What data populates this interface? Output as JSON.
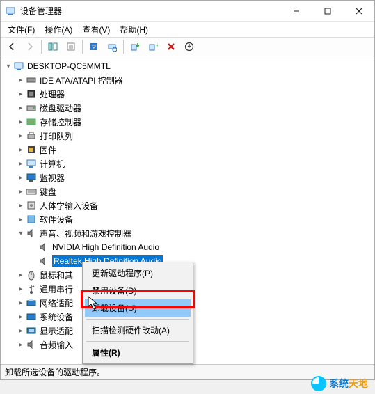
{
  "titlebar": {
    "title": "设备管理器"
  },
  "menu": {
    "file": "文件(F)",
    "action": "操作(A)",
    "view": "查看(V)",
    "help": "帮助(H)"
  },
  "tree": {
    "root": "DESKTOP-QC5MMTL",
    "items": [
      {
        "label": "IDE ATA/ATAPI 控制器"
      },
      {
        "label": "处理器"
      },
      {
        "label": "磁盘驱动器"
      },
      {
        "label": "存储控制器"
      },
      {
        "label": "打印队列"
      },
      {
        "label": "固件"
      },
      {
        "label": "计算机"
      },
      {
        "label": "监视器"
      },
      {
        "label": "键盘"
      },
      {
        "label": "人体学输入设备"
      },
      {
        "label": "软件设备"
      },
      {
        "label": "声音、视频和游戏控制器"
      },
      {
        "label": "NVIDIA High Definition Audio"
      },
      {
        "label": "Realtek High Definition Audio"
      },
      {
        "label": "鼠标和其"
      },
      {
        "label": "通用串行"
      },
      {
        "label": "网络适配"
      },
      {
        "label": "系统设备"
      },
      {
        "label": "显示适配"
      },
      {
        "label": "音频输入"
      }
    ]
  },
  "context": {
    "update": "更新驱动程序(P)",
    "disable": "禁用设备(D)",
    "uninstall": "卸载设备(U)",
    "scan": "扫描检测硬件改动(A)",
    "prop": "属性(R)"
  },
  "status": "卸载所选设备的驱动程序。",
  "watermark": {
    "a": "系统",
    "b": "天地"
  }
}
